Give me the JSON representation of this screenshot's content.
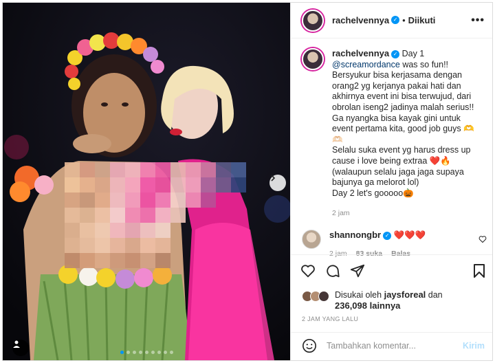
{
  "post": {
    "username": "rachelvennya",
    "verified_glyph": "✓",
    "separator": "•",
    "follow_label": "Diikuti",
    "more_label": "•••",
    "caption_lines": [
      "Day 1",
      "@screamordance was so fun!!",
      "Bersyukur bisa kerjasama dengan",
      "orang2 yg kerjanya pakai hati dan",
      "akhirnya event ini bisa terwujud, dari",
      "obrolan iseng2 jadinya malah serius!!",
      "Ga nyangka bisa kayak gini untuk",
      "event pertama kita, good job guys 🫶",
      "🫶🏻",
      "Selalu suka event yg harus dress up",
      "cause i love being extraa ❤️🔥",
      "(walaupun selalu jaga jaga supaya",
      "bajunya ga melorot lol)",
      "Day 2 let's gooooo🎃"
    ],
    "mention": "@screamordance",
    "mention_suffix": " was so fun!!",
    "caption_time": "2 jam",
    "image_icons": [
      "chevron-right-icon",
      "user-tag-icon"
    ],
    "carousel": {
      "total": 9,
      "active": 0
    }
  },
  "comment": {
    "username": "shannongbr",
    "text": "❤️❤️❤️",
    "time": "2 jam",
    "likes": "83 suka",
    "reply": "Balas"
  },
  "actions": {
    "icons": [
      "heart-icon",
      "comment-icon",
      "share-icon",
      "bookmark-icon"
    ],
    "liked_by_prefix": "Disukai oleh ",
    "liked_by_user": "jaysforeal",
    "liked_by_suffix": " dan",
    "others": "236,098 lainnya",
    "date": "2 JAM YANG LALU"
  },
  "comment_bar": {
    "icon": "emoji-icon",
    "placeholder": "Tambahkan komentar...",
    "post_label": "Kirim"
  },
  "colors": {
    "accent": "#0095f6",
    "mention": "#00376b",
    "muted": "#8e8e8e",
    "like_red": "#ed4956"
  }
}
